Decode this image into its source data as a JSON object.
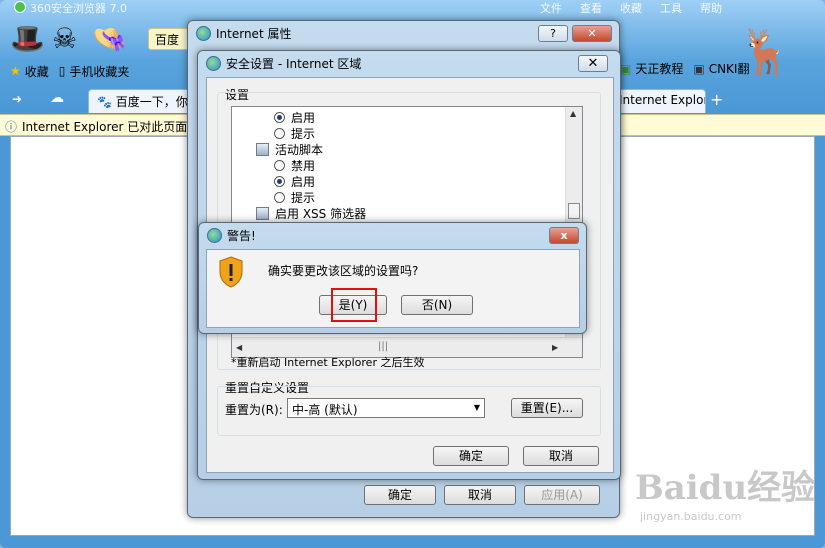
{
  "browser": {
    "title": "360安全浏览器 7.0",
    "menu": [
      "文件",
      "查看",
      "收藏",
      "工具",
      "帮助"
    ],
    "search_engine": "百度",
    "favorites": {
      "label": "收藏",
      "mobile": "手机收藏夹",
      "tianzheng": "天正教程",
      "cnki": "CNKI翻"
    },
    "tabs": [
      {
        "label": "百度一下，你就"
      },
      {
        "label": "Internet Explorer E"
      }
    ],
    "infobar_text": "Internet Explorer 已对此页面进",
    "watermark": "Baidu经验",
    "watermark_sub": "jingyan.baidu.com"
  },
  "ie_properties": {
    "title": "Internet 属性",
    "help": "?",
    "buttons": [
      "确定",
      "取消",
      "应用(A)"
    ]
  },
  "security": {
    "title": "安全设置 - Internet 区域",
    "settings_label": "设置",
    "list": [
      {
        "type": "radio",
        "label": "启用",
        "checked": true
      },
      {
        "type": "radio",
        "label": "提示",
        "checked": false
      },
      {
        "type": "header",
        "label": "活动脚本"
      },
      {
        "type": "radio",
        "label": "禁用",
        "checked": false
      },
      {
        "type": "radio",
        "label": "启用",
        "checked": true
      },
      {
        "type": "radio",
        "label": "提示",
        "checked": false
      },
      {
        "type": "header",
        "label": "启用 XSS 筛选器"
      }
    ],
    "restart_note": "*重新启动 Internet Explorer 之后生效",
    "reset_group_label": "重置自定义设置",
    "reset_to_label": "重置为(R):",
    "reset_to_value": "中-高 (默认)",
    "reset_button": "重置(E)...",
    "ok": "确定",
    "cancel": "取消"
  },
  "warning": {
    "title": "警告!",
    "message": "确实要更改该区域的设置吗?",
    "yes": "是(Y)",
    "no": "否(N)",
    "close": "x"
  }
}
